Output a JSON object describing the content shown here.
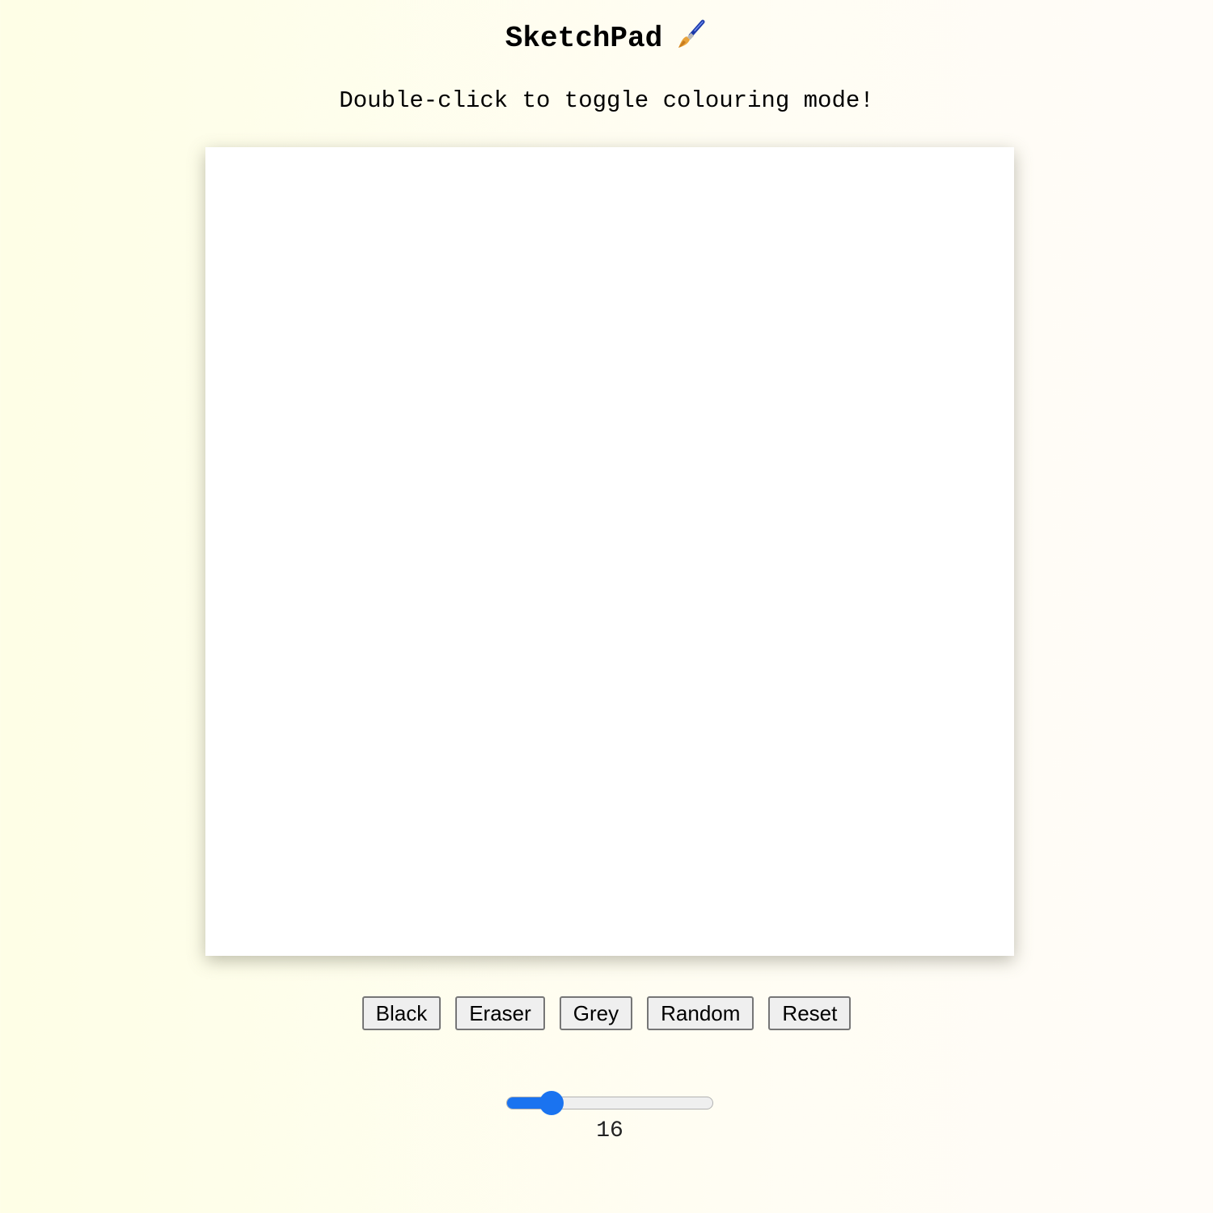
{
  "header": {
    "title": "SketchPad",
    "icon": "paintbrush-icon",
    "subtitle": "Double-click to toggle colouring mode!"
  },
  "buttons": {
    "black": "Black",
    "eraser": "Eraser",
    "grey": "Grey",
    "random": "Random",
    "reset": "Reset"
  },
  "grid_size": {
    "value": "16",
    "min": 1,
    "max": 100,
    "fraction": 0.18
  },
  "colors": {
    "accent": "#1a73f0",
    "canvas": "#ffffff",
    "background": "#fefee6"
  }
}
